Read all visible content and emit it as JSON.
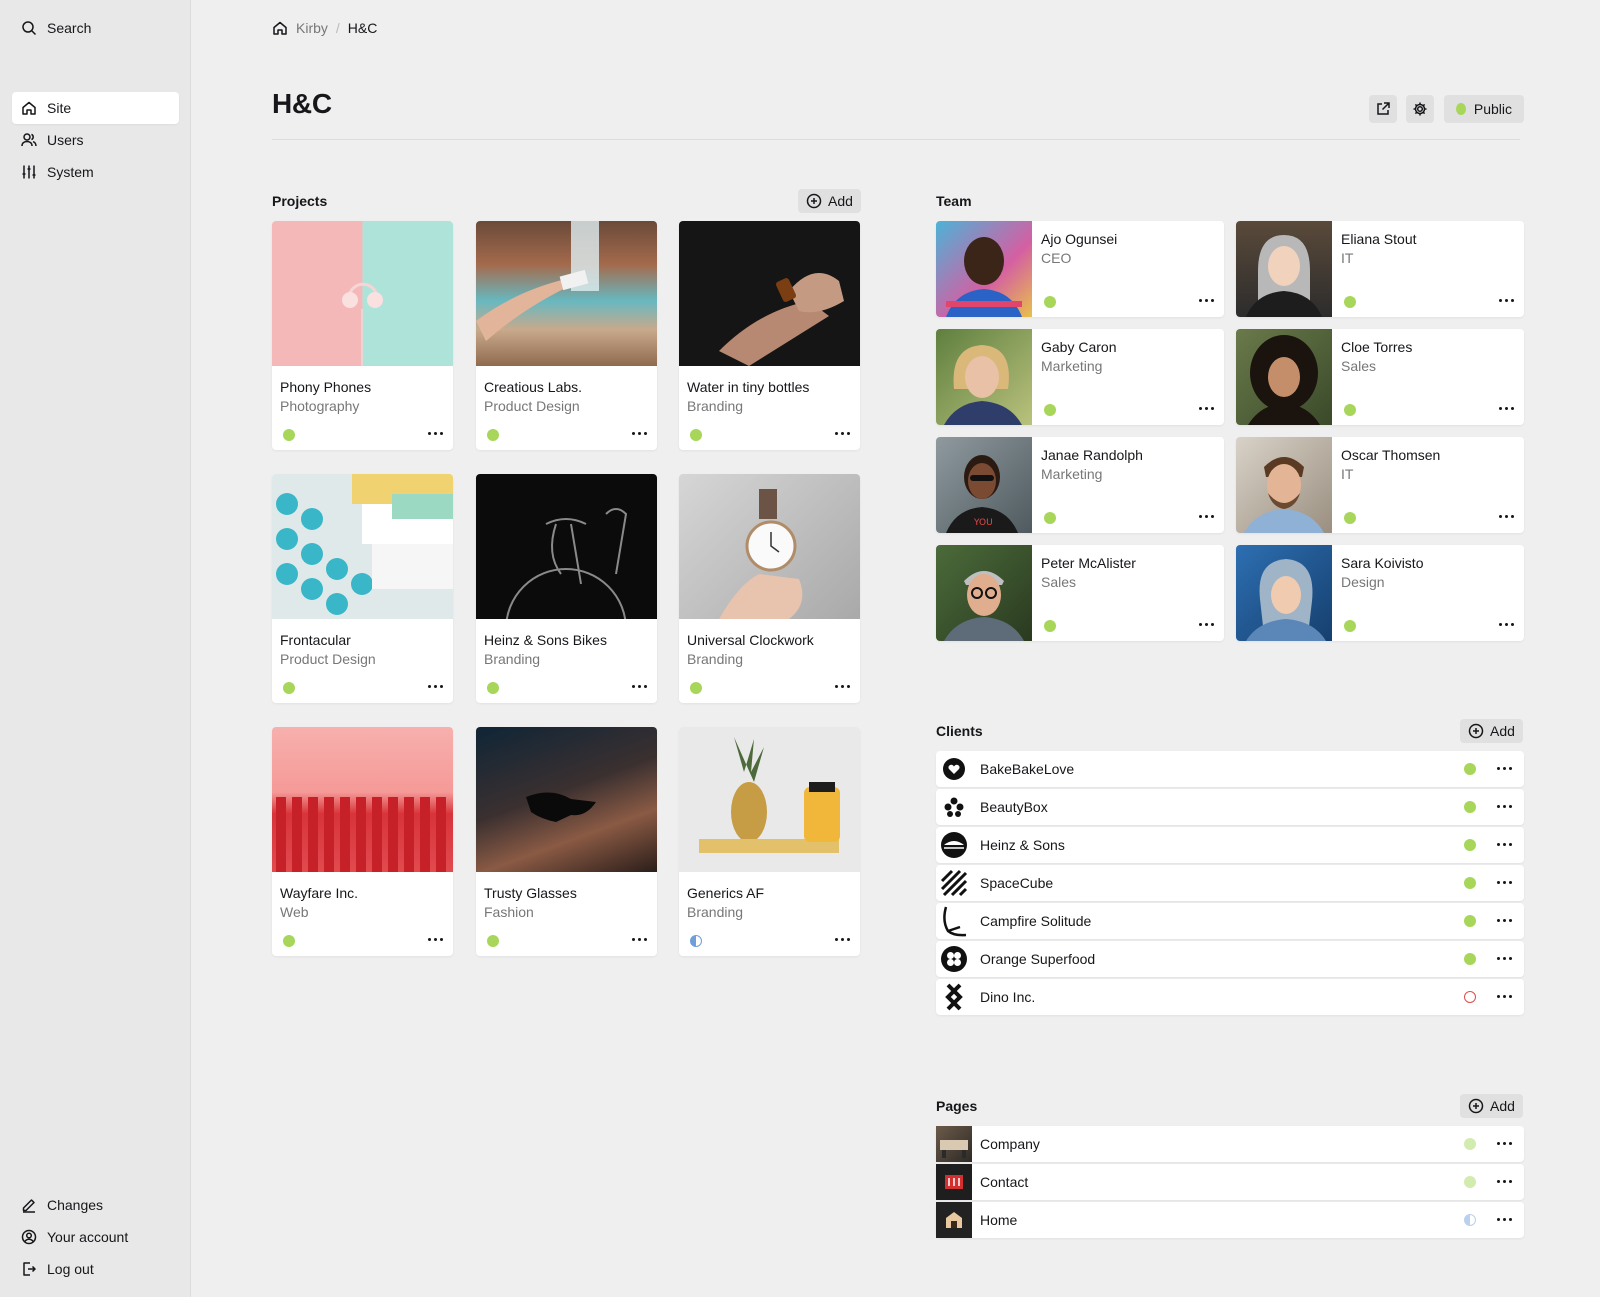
{
  "sidebar": {
    "search_label": "Search",
    "menu": [
      {
        "label": "Site",
        "icon": "home-icon",
        "active": true
      },
      {
        "label": "Users",
        "icon": "users-icon",
        "active": false
      },
      {
        "label": "System",
        "icon": "settings-sliders-icon",
        "active": false
      }
    ],
    "bottom": [
      {
        "label": "Changes",
        "icon": "edit-icon"
      },
      {
        "label": "Your account",
        "icon": "account-icon"
      },
      {
        "label": "Log out",
        "icon": "logout-icon"
      }
    ]
  },
  "breadcrumb": {
    "root": "Kirby",
    "separator": "/",
    "current": "H&C"
  },
  "header": {
    "title": "H&C",
    "status_label": "Public"
  },
  "projects": {
    "title": "Projects",
    "add_label": "Add",
    "items": [
      {
        "title": "Phony Phones",
        "category": "Photography",
        "status": "published"
      },
      {
        "title": "Creatious Labs.",
        "category": "Product Design",
        "status": "published"
      },
      {
        "title": "Water in tiny bottles",
        "category": "Branding",
        "status": "published"
      },
      {
        "title": "Frontacular",
        "category": "Product Design",
        "status": "published"
      },
      {
        "title": "Heinz & Sons Bikes",
        "category": "Branding",
        "status": "published"
      },
      {
        "title": "Universal Clockwork",
        "category": "Branding",
        "status": "published"
      },
      {
        "title": "Wayfare Inc.",
        "category": "Web",
        "status": "published"
      },
      {
        "title": "Trusty Glasses",
        "category": "Fashion",
        "status": "published"
      },
      {
        "title": "Generics AF",
        "category": "Branding",
        "status": "unlisted"
      }
    ]
  },
  "team": {
    "title": "Team",
    "members": [
      {
        "name": "Ajo Ogunsei",
        "role": "CEO"
      },
      {
        "name": "Eliana Stout",
        "role": "IT"
      },
      {
        "name": "Gaby Caron",
        "role": "Marketing"
      },
      {
        "name": "Cloe Torres",
        "role": "Sales"
      },
      {
        "name": "Janae Randolph",
        "role": "Marketing"
      },
      {
        "name": "Oscar Thomsen",
        "role": "IT"
      },
      {
        "name": "Peter McAlister",
        "role": "Sales"
      },
      {
        "name": "Sara Koivisto",
        "role": "Design"
      }
    ]
  },
  "clients": {
    "title": "Clients",
    "add_label": "Add",
    "items": [
      {
        "name": "BakeBakeLove",
        "status": "published"
      },
      {
        "name": "BeautyBox",
        "status": "published"
      },
      {
        "name": "Heinz & Sons",
        "status": "published"
      },
      {
        "name": "SpaceCube",
        "status": "published"
      },
      {
        "name": "Campfire Solitude",
        "status": "published"
      },
      {
        "name": "Orange Superfood",
        "status": "published"
      },
      {
        "name": "Dino Inc.",
        "status": "draft"
      }
    ]
  },
  "pages": {
    "title": "Pages",
    "add_label": "Add",
    "items": [
      {
        "name": "Company",
        "status": "published"
      },
      {
        "name": "Contact",
        "status": "published"
      },
      {
        "name": "Home",
        "status": "unlisted"
      }
    ]
  },
  "colors": {
    "accent_green": "#a7d65b",
    "draft_red": "#e24b4b",
    "unlisted_blue": "#6e9fd9"
  }
}
